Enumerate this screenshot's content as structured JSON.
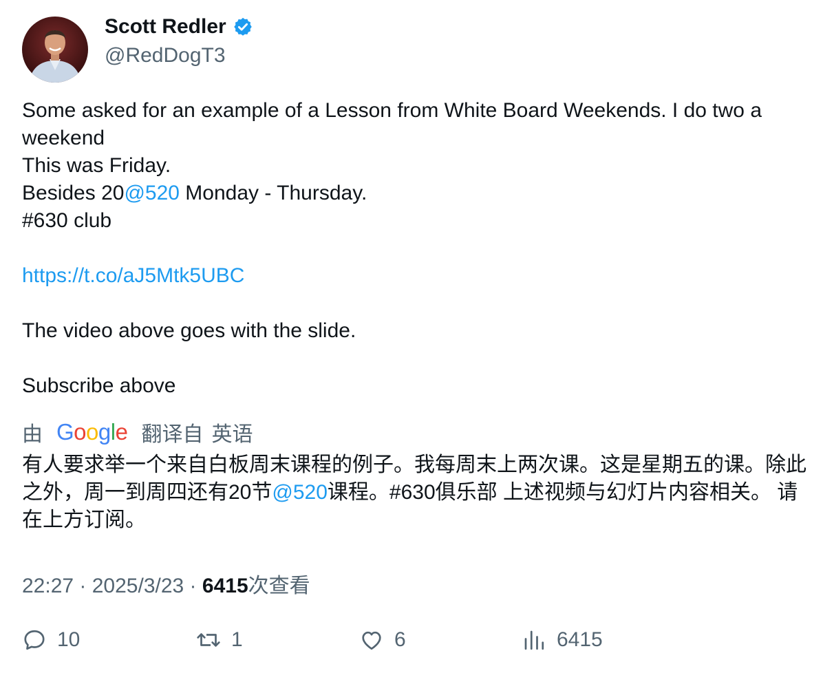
{
  "author": {
    "name": "Scott Redler",
    "handle": "@RedDogT3"
  },
  "tweet": {
    "line1": "Some asked for an example of a Lesson from White  Board Weekends. I do two a weekend",
    "line2": "This was Friday.",
    "line3_prefix": "Besides 20",
    "line3_mention": "@520",
    "line3_suffix": " Monday - Thursday.",
    "line4": "#630 club",
    "link": "https://t.co/aJ5Mtk5UBC",
    "line5": "The video above goes with the slide.",
    "line6": "Subscribe above"
  },
  "translation": {
    "by": "由",
    "provider": "Google",
    "from_label": "翻译自",
    "language": "英语",
    "text_prefix": "有人要求举一个来自白板周末课程的例子。我每周末上两次课。这是星期五的课。除此之外，周一到周四还有20节",
    "text_mention": "@520",
    "text_suffix": "课程。#630俱乐部 上述视频与幻灯片内容相关。 请在上方订阅。"
  },
  "meta": {
    "time": "22:27",
    "separator": " · ",
    "date": "2025/3/23",
    "views_count": "6415",
    "views_label": "次查看"
  },
  "actions": {
    "replies": "10",
    "retweets": "1",
    "likes": "6",
    "views": "6415"
  },
  "colors": {
    "link": "#1d9bf0",
    "secondary_text": "#536471",
    "primary_text": "#0f1419",
    "verified": "#1d9bf0"
  },
  "icons": [
    "verified-badge-icon",
    "reply-icon",
    "retweet-icon",
    "like-icon",
    "views-icon"
  ]
}
